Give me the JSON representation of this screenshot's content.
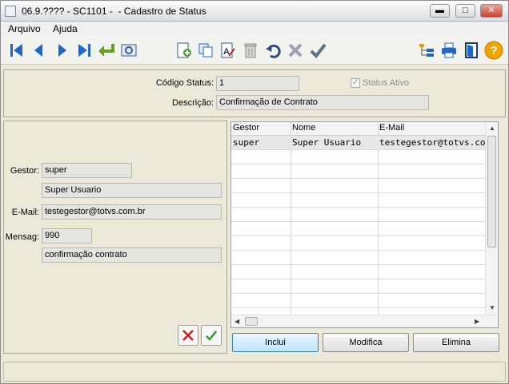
{
  "window": {
    "title": "06.9.???? - SC1101 -  - Cadastro de Status"
  },
  "titlebar_buttons": {
    "minimize": "▬",
    "maximize": "□",
    "close": "✕"
  },
  "menu": {
    "items": [
      "Arquivo",
      "Ajuda"
    ]
  },
  "toolbar": {
    "icons": [
      "first-icon",
      "previous-icon",
      "next-icon",
      "last-icon",
      "return-icon",
      "search-preview-icon",
      "new-icon",
      "copy-icon",
      "edit-icon",
      "delete-icon",
      "undo-icon",
      "cancel-icon",
      "save-check-icon",
      "tree-icon",
      "print-icon",
      "exit-icon",
      "help-icon"
    ],
    "help_glyph": "?"
  },
  "header_form": {
    "codigo_label": "Código Status:",
    "codigo_value": "1",
    "status_ativo_label": "Status Ativo",
    "status_ativo_checked": true,
    "descricao_label": "Descrição:",
    "descricao_value": "Confirmação de Contrato"
  },
  "detail_form": {
    "gestor_label": "Gestor:",
    "gestor_value": "super",
    "gestor_name": "Super Usuario",
    "email_label": "E-Mail:",
    "email_value": "testegestor@totvs.com.br",
    "mensag_label": "Mensag:",
    "mensag_value": "990",
    "mensag_desc": "confirmação contrato"
  },
  "grid": {
    "headers": [
      "Gestor",
      "Nome",
      "E-Mail"
    ],
    "rows": [
      [
        "super",
        "Super Usuario",
        "testegestor@totvs.com"
      ]
    ]
  },
  "buttons": {
    "inclui": "Inclui",
    "modifica": "Modifica",
    "elimina": "Elimina"
  },
  "colors": {
    "accent_blue": "#1f66c8",
    "help_yellow": "#f2a300",
    "cancel_red": "#d01c1c",
    "confirm_green": "#2f9a2f"
  }
}
